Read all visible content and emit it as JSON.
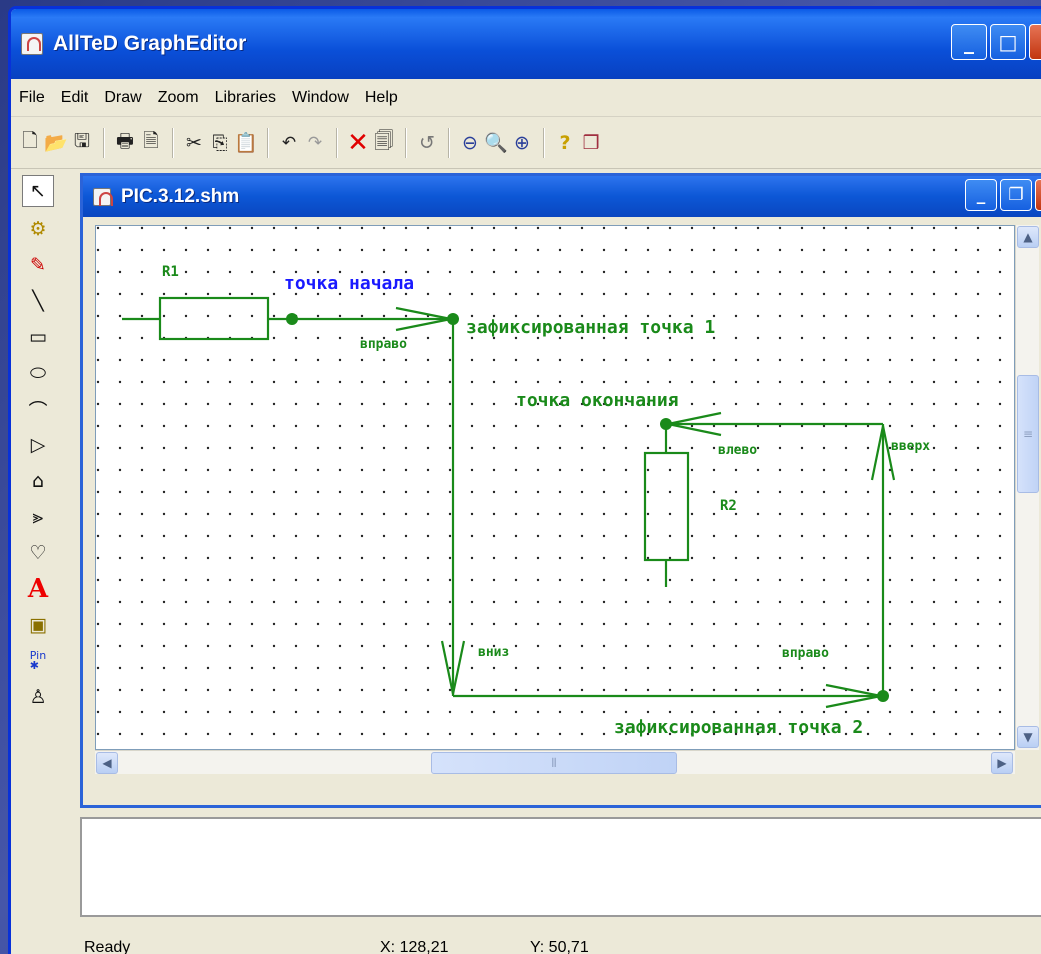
{
  "app": {
    "title": "AllTeD GraphEditor"
  },
  "menu": [
    "File",
    "Edit",
    "Draw",
    "Zoom",
    "Libraries",
    "Window",
    "Help"
  ],
  "toolbar_icons": [
    "new-file",
    "open-folder",
    "save",
    "print",
    "print-preview",
    "cut",
    "copy",
    "paste",
    "undo",
    "redo",
    "delete",
    "properties",
    "refresh",
    "zoom-out",
    "zoom-fit",
    "zoom-in",
    "help",
    "library"
  ],
  "left_tools": [
    "select-arrow",
    "component",
    "pencil",
    "line",
    "rectangle",
    "ellipse",
    "arc",
    "triangle",
    "bell",
    "chevron-shape",
    "heart-shape",
    "text",
    "chip",
    "pin",
    "connector"
  ],
  "document": {
    "title": "PIC.3.12.shm"
  },
  "diagram": {
    "r1": "R1",
    "r2": "R2",
    "start": "точка начала",
    "fixed1": "зафиксированная точка 1",
    "fixed2": "зафиксированная точка 2",
    "end": "точка окончания",
    "right1": "вправо",
    "down": "вниз",
    "right2": "вправо",
    "up": "вверх",
    "left": "влево"
  },
  "status": {
    "text": "Ready",
    "x": "X: 128,21",
    "y": "Y: 50,71"
  },
  "colors": {
    "wire": "#1a8a1a",
    "label_blue": "#1a1aff",
    "title_bar": "#0a52e0"
  }
}
